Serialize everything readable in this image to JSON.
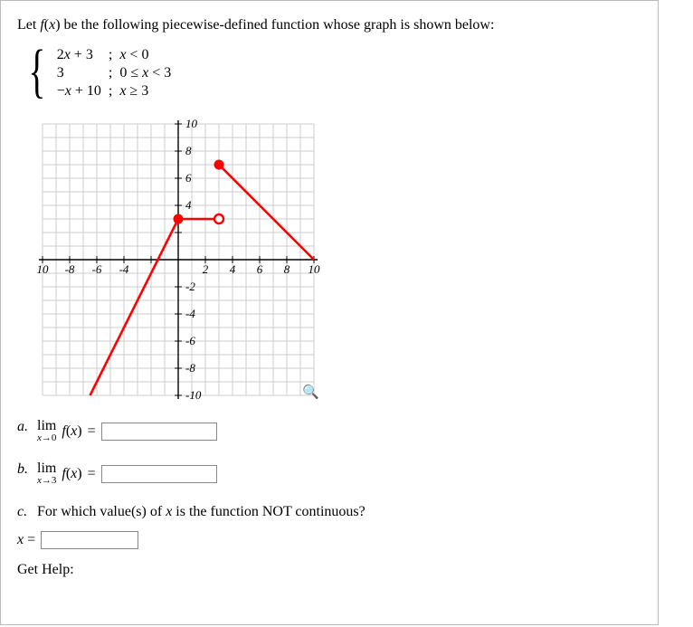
{
  "intro": "Let f(x) be the following piecewise-defined function whose graph is shown below:",
  "piecewise": {
    "rows": [
      {
        "expr": "2x + 3",
        "sep": ";",
        "cond": "x < 0"
      },
      {
        "expr": "3",
        "sep": ";",
        "cond": "0 ≤ x < 3"
      },
      {
        "expr": "−x + 10",
        "sep": ";",
        "cond": "x ≥ 3"
      }
    ]
  },
  "chart_data": {
    "type": "line",
    "xlim": [
      -10,
      10
    ],
    "ylim": [
      -10,
      10
    ],
    "x_ticks": [
      -10,
      -8,
      -6,
      -4,
      -2,
      2,
      4,
      6,
      8,
      10
    ],
    "x_tick_labels": [
      "10",
      "-8",
      "-6",
      "-4",
      "",
      "2",
      "4",
      "6",
      "8",
      "10"
    ],
    "y_ticks": [
      -10,
      -8,
      -6,
      -4,
      -2,
      2,
      4,
      6,
      8,
      10
    ],
    "y_tick_labels": [
      "-10",
      "-8",
      "-6",
      "-4",
      "-2",
      "",
      "4",
      "6",
      "8",
      "10"
    ],
    "series": [
      {
        "name": "f1",
        "points": [
          [
            -6.5,
            -10
          ],
          [
            0,
            3
          ]
        ],
        "open_end": "right"
      },
      {
        "name": "f2",
        "points": [
          [
            0,
            3
          ],
          [
            3,
            3
          ]
        ],
        "open_end": "right",
        "closed_start": true
      },
      {
        "name": "f3",
        "points": [
          [
            3,
            7
          ],
          [
            10,
            0
          ]
        ],
        "closed_start": true
      }
    ],
    "markers": [
      {
        "x": 0,
        "y": 3,
        "type": "closed"
      },
      {
        "x": 3,
        "y": 3,
        "type": "open"
      },
      {
        "x": 3,
        "y": 7,
        "type": "closed"
      }
    ],
    "line_color": "#ff0000"
  },
  "questions": {
    "a": {
      "label": "a.",
      "prefix": "lim",
      "sub": "x→0",
      "func": "f(x)",
      "eq": "=",
      "answer": ""
    },
    "b": {
      "label": "b.",
      "prefix": "lim",
      "sub": "x→3",
      "func": "f(x)",
      "eq": "=",
      "answer": ""
    },
    "c": {
      "label": "c.",
      "text": "For which value(s) of x is the function NOT continuous?",
      "xeq": "x =",
      "answer": ""
    }
  },
  "get_help": "Get Help:"
}
